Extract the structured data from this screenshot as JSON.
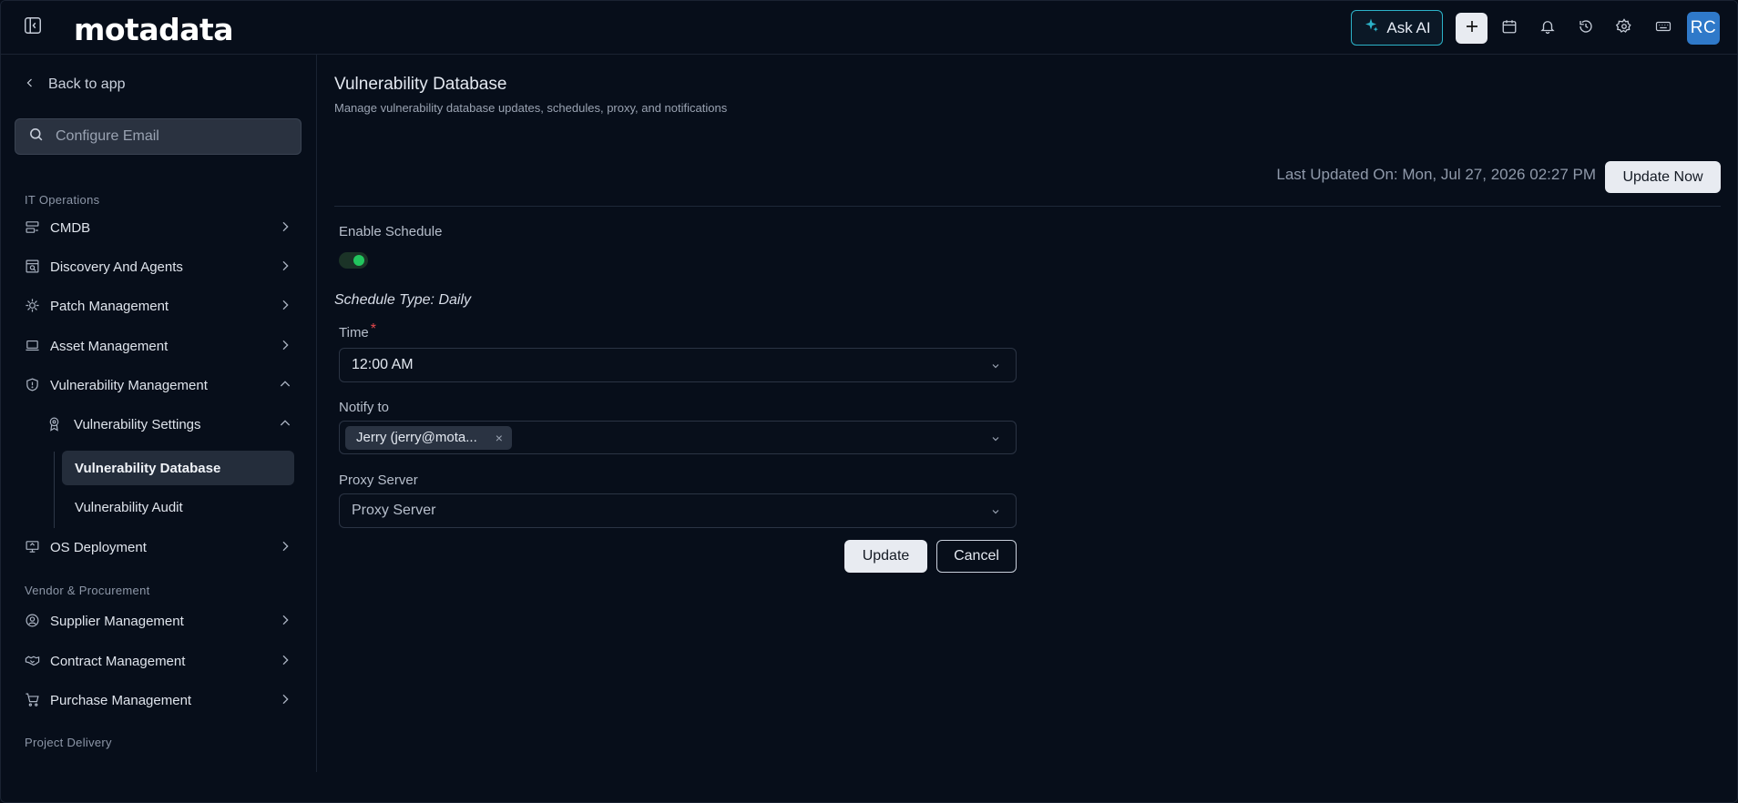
{
  "app": {
    "logo_text": "motadata",
    "ask_ai_label": "Ask AI",
    "avatar_initials": "RC"
  },
  "colors": {
    "accent_cyan": "#2cb3c9",
    "toggle_on": "#22c55e",
    "avatar_bg": "#2f79c9",
    "required": "#e5484d"
  },
  "icons": [
    "sidebar-collapse-icon",
    "sparkle-icon",
    "plus-icon",
    "calendar-icon",
    "bell-icon",
    "history-icon",
    "gear-icon",
    "keyboard-icon"
  ],
  "sidebar": {
    "back_label": "Back to app",
    "search_placeholder": "Configure Email",
    "sections": [
      {
        "label": "IT Operations"
      },
      {
        "label": "Vendor & Procurement"
      },
      {
        "label": "Project Delivery"
      }
    ],
    "items": {
      "cmdb": "CMDB",
      "discovery": "Discovery And Agents",
      "patch": "Patch Management",
      "asset": "Asset Management",
      "vuln_mgmt": "Vulnerability Management",
      "vuln_settings": "Vulnerability Settings",
      "vuln_db": "Vulnerability Database",
      "vuln_audit": "Vulnerability Audit",
      "os_deploy": "OS Deployment",
      "supplier": "Supplier Management",
      "contract": "Contract Management",
      "purchase": "Purchase Management"
    }
  },
  "main": {
    "title": "Vulnerability Database",
    "subtitle": "Manage vulnerability database updates, schedules, proxy, and notifications",
    "last_updated": "Last Updated On: Mon, Jul 27, 2026 02:27 PM",
    "update_now_label": "Update Now",
    "enable_schedule_label": "Enable Schedule",
    "enable_schedule_on": true,
    "schedule_type": "Schedule Type: Daily",
    "time_label": "Time",
    "required_mark": "*",
    "time_value": "12:00 AM",
    "notify_label": "Notify to",
    "notify_chip": "Jerry (jerry@mota...",
    "chip_remove": "×",
    "proxy_label": "Proxy Server",
    "proxy_placeholder": "Proxy Server",
    "update_label": "Update",
    "cancel_label": "Cancel"
  }
}
